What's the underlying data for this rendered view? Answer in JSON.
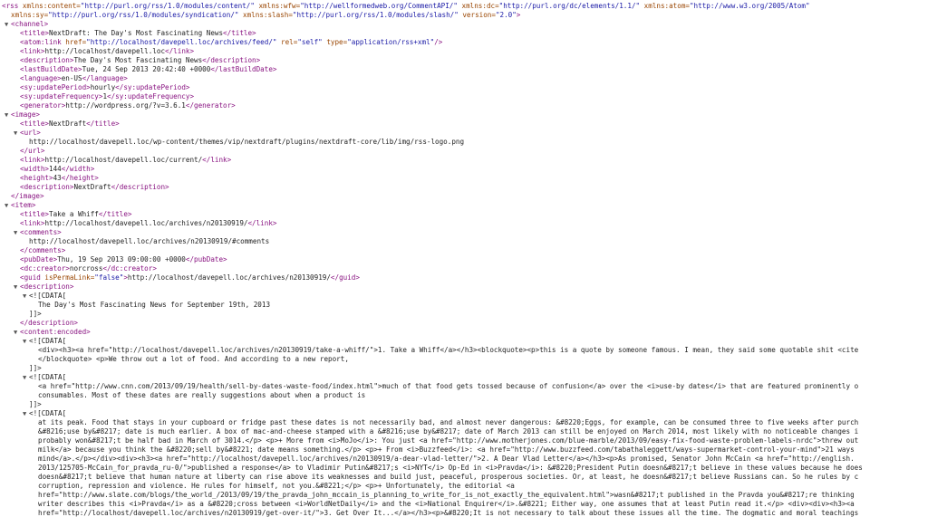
{
  "document": {
    "lines": [
      {
        "level": 0,
        "toggle": "▼",
        "tokens": [
          {
            "t": "tg",
            "v": "<rss"
          },
          {
            "t": "at",
            "v": " xmlns:content="
          },
          {
            "t": "av",
            "v": "\"http://purl.org/rss/1.0/modules/content/\""
          },
          {
            "t": "at",
            "v": " xmlns:wfw="
          },
          {
            "t": "av",
            "v": "\"http://wellformedweb.org/CommentAPI/\""
          },
          {
            "t": "at",
            "v": " xmlns:dc="
          },
          {
            "t": "av",
            "v": "\"http://purl.org/dc/elements/1.1/\""
          },
          {
            "t": "at",
            "v": " xmlns:atom="
          },
          {
            "t": "av",
            "v": "\"http://www.w3.org/2005/Atom\""
          }
        ]
      },
      {
        "level": 1,
        "tokens": [
          {
            "t": "at",
            "v": "xmlns:sy="
          },
          {
            "t": "av",
            "v": "\"http://purl.org/rss/1.0/modules/syndication/\""
          },
          {
            "t": "at",
            "v": " xmlns:slash="
          },
          {
            "t": "av",
            "v": "\"http://purl.org/rss/1.0/modules/slash/\""
          },
          {
            "t": "at",
            "v": " version="
          },
          {
            "t": "av",
            "v": "\"2.0\""
          },
          {
            "t": "tg",
            "v": ">"
          }
        ]
      },
      {
        "level": 1,
        "toggle": "▼",
        "tokens": [
          {
            "t": "tg",
            "v": "<channel>"
          }
        ]
      },
      {
        "level": 2,
        "tokens": [
          {
            "t": "tg",
            "v": "<title>"
          },
          {
            "t": "tx",
            "v": "NextDraft: The Day's Most Fascinating News"
          },
          {
            "t": "tg",
            "v": "</title>"
          }
        ]
      },
      {
        "level": 2,
        "tokens": [
          {
            "t": "tg",
            "v": "<atom:link"
          },
          {
            "t": "at",
            "v": " href="
          },
          {
            "t": "av",
            "v": "\"http://localhost/davepell.loc/archives/feed/\""
          },
          {
            "t": "at",
            "v": " rel="
          },
          {
            "t": "av",
            "v": "\"self\""
          },
          {
            "t": "at",
            "v": " type="
          },
          {
            "t": "av",
            "v": "\"application/rss+xml\""
          },
          {
            "t": "tg",
            "v": "/>"
          }
        ]
      },
      {
        "level": 2,
        "tokens": [
          {
            "t": "tg",
            "v": "<link>"
          },
          {
            "t": "tx",
            "v": "http://localhost/davepell.loc"
          },
          {
            "t": "tg",
            "v": "</link>"
          }
        ]
      },
      {
        "level": 2,
        "tokens": [
          {
            "t": "tg",
            "v": "<description>"
          },
          {
            "t": "tx",
            "v": "The Day's Most Fascinating News"
          },
          {
            "t": "tg",
            "v": "</description>"
          }
        ]
      },
      {
        "level": 2,
        "tokens": [
          {
            "t": "tg",
            "v": "<lastBuildDate>"
          },
          {
            "t": "tx",
            "v": "Tue, 24 Sep 2013 20:42:40 +0000"
          },
          {
            "t": "tg",
            "v": "</lastBuildDate>"
          }
        ]
      },
      {
        "level": 2,
        "tokens": [
          {
            "t": "tg",
            "v": "<language>"
          },
          {
            "t": "tx",
            "v": "en-US"
          },
          {
            "t": "tg",
            "v": "</language>"
          }
        ]
      },
      {
        "level": 2,
        "tokens": [
          {
            "t": "tg",
            "v": "<sy:updatePeriod>"
          },
          {
            "t": "tx",
            "v": "hourly"
          },
          {
            "t": "tg",
            "v": "</sy:updatePeriod>"
          }
        ]
      },
      {
        "level": 2,
        "tokens": [
          {
            "t": "tg",
            "v": "<sy:updateFrequency>"
          },
          {
            "t": "tx",
            "v": "1"
          },
          {
            "t": "tg",
            "v": "</sy:updateFrequency>"
          }
        ]
      },
      {
        "level": 2,
        "tokens": [
          {
            "t": "tg",
            "v": "<generator>"
          },
          {
            "t": "tx",
            "v": "http://wordpress.org/?v=3.6.1"
          },
          {
            "t": "tg",
            "v": "</generator>"
          }
        ]
      },
      {
        "level": 1,
        "toggle": "▼",
        "tokens": [
          {
            "t": "tg",
            "v": "<image>"
          }
        ]
      },
      {
        "level": 2,
        "tokens": [
          {
            "t": "tg",
            "v": "<title>"
          },
          {
            "t": "tx",
            "v": "NextDraft"
          },
          {
            "t": "tg",
            "v": "</title>"
          }
        ]
      },
      {
        "level": 2,
        "toggle": "▼",
        "tokens": [
          {
            "t": "tg",
            "v": "<url>"
          }
        ]
      },
      {
        "level": 3,
        "tokens": [
          {
            "t": "tx",
            "v": "http://localhost/davepell.loc/wp-content/themes/vip/nextdraft/plugins/nextdraft-core/lib/img/rss-logo.png"
          }
        ]
      },
      {
        "level": 2,
        "tokens": [
          {
            "t": "tg",
            "v": "</url>"
          }
        ]
      },
      {
        "level": 2,
        "tokens": [
          {
            "t": "tg",
            "v": "<link>"
          },
          {
            "t": "tx",
            "v": "http://localhost/davepell.loc/current/"
          },
          {
            "t": "tg",
            "v": "</link>"
          }
        ]
      },
      {
        "level": 2,
        "tokens": [
          {
            "t": "tg",
            "v": "<width>"
          },
          {
            "t": "tx",
            "v": "144"
          },
          {
            "t": "tg",
            "v": "</width>"
          }
        ]
      },
      {
        "level": 2,
        "tokens": [
          {
            "t": "tg",
            "v": "<height>"
          },
          {
            "t": "tx",
            "v": "43"
          },
          {
            "t": "tg",
            "v": "</height>"
          }
        ]
      },
      {
        "level": 2,
        "tokens": [
          {
            "t": "tg",
            "v": "<description>"
          },
          {
            "t": "tx",
            "v": "NextDraft"
          },
          {
            "t": "tg",
            "v": "</description>"
          }
        ]
      },
      {
        "level": 1,
        "tokens": [
          {
            "t": "tg",
            "v": "</image>"
          }
        ]
      },
      {
        "level": 1,
        "toggle": "▼",
        "tokens": [
          {
            "t": "tg",
            "v": "<item>"
          }
        ]
      },
      {
        "level": 2,
        "tokens": [
          {
            "t": "tg",
            "v": "<title>"
          },
          {
            "t": "tx",
            "v": "Take a Whiff"
          },
          {
            "t": "tg",
            "v": "</title>"
          }
        ]
      },
      {
        "level": 2,
        "tokens": [
          {
            "t": "tg",
            "v": "<link>"
          },
          {
            "t": "tx",
            "v": "http://localhost/davepell.loc/archives/n20130919/"
          },
          {
            "t": "tg",
            "v": "</link>"
          }
        ]
      },
      {
        "level": 2,
        "toggle": "▼",
        "tokens": [
          {
            "t": "tg",
            "v": "<comments>"
          }
        ]
      },
      {
        "level": 3,
        "tokens": [
          {
            "t": "tx",
            "v": "http://localhost/davepell.loc/archives/n20130919/#comments"
          }
        ]
      },
      {
        "level": 2,
        "tokens": [
          {
            "t": "tg",
            "v": "</comments>"
          }
        ]
      },
      {
        "level": 2,
        "tokens": [
          {
            "t": "tg",
            "v": "<pubDate>"
          },
          {
            "t": "tx",
            "v": "Thu, 19 Sep 2013 09:00:00 +0000"
          },
          {
            "t": "tg",
            "v": "</pubDate>"
          }
        ]
      },
      {
        "level": 2,
        "tokens": [
          {
            "t": "tg",
            "v": "<dc:creator>"
          },
          {
            "t": "tx",
            "v": "norcross"
          },
          {
            "t": "tg",
            "v": "</dc:creator>"
          }
        ]
      },
      {
        "level": 2,
        "tokens": [
          {
            "t": "tg",
            "v": "<guid"
          },
          {
            "t": "at",
            "v": " isPermaLink="
          },
          {
            "t": "av",
            "v": "\"false\""
          },
          {
            "t": "tg",
            "v": ">"
          },
          {
            "t": "tx",
            "v": "http://localhost/davepell.loc/archives/n20130919/"
          },
          {
            "t": "tg",
            "v": "</guid>"
          }
        ]
      },
      {
        "level": 2,
        "toggle": "▼",
        "tokens": [
          {
            "t": "tg",
            "v": "<description>"
          }
        ]
      },
      {
        "level": 3,
        "toggle": "▼",
        "tokens": [
          {
            "t": "tx",
            "v": "<![CDATA["
          }
        ]
      },
      {
        "level": 4,
        "tokens": [
          {
            "t": "tx",
            "v": "The Day's Most Fascinating News for September 19th, 2013"
          }
        ]
      },
      {
        "level": 3,
        "tokens": [
          {
            "t": "tx",
            "v": "]]>"
          }
        ]
      },
      {
        "level": 2,
        "tokens": [
          {
            "t": "tg",
            "v": "</description>"
          }
        ]
      },
      {
        "level": 2,
        "toggle": "▼",
        "tokens": [
          {
            "t": "tg",
            "v": "<content:encoded>"
          }
        ]
      },
      {
        "level": 3,
        "toggle": "▼",
        "tokens": [
          {
            "t": "tx",
            "v": "<![CDATA["
          }
        ]
      },
      {
        "level": 4,
        "tokens": [
          {
            "t": "tx",
            "v": "<div><h3><a href=\"http://localhost/davepell.loc/archives/n20130919/take-a-whiff/\">1. Take a Whiff</a></h3><blockquote><p>this is a quote by someone famous. I mean, they said some quotable shit <cite"
          }
        ]
      },
      {
        "level": 4,
        "tokens": [
          {
            "t": "tx",
            "v": "</blockquote> <p>We throw out a lot of food. And according to a new report,"
          }
        ]
      },
      {
        "level": 3,
        "tokens": [
          {
            "t": "tx",
            "v": "]]>"
          }
        ]
      },
      {
        "level": 3,
        "toggle": "▼",
        "tokens": [
          {
            "t": "tx",
            "v": "<![CDATA["
          }
        ]
      },
      {
        "level": 4,
        "tokens": [
          {
            "t": "tx",
            "v": "<a href=\"http://www.cnn.com/2013/09/19/health/sell-by-dates-waste-food/index.html\">much of that food gets tossed because of confusion</a> over the <i>use-by dates</i> that are featured prominently o"
          }
        ]
      },
      {
        "level": 4,
        "tokens": [
          {
            "t": "tx",
            "v": "consumables. Most of these dates are really suggestions about when a product is"
          }
        ]
      },
      {
        "level": 3,
        "tokens": [
          {
            "t": "tx",
            "v": "]]>"
          }
        ]
      },
      {
        "level": 3,
        "toggle": "▼",
        "tokens": [
          {
            "t": "tx",
            "v": "<![CDATA["
          }
        ]
      },
      {
        "level": 4,
        "tokens": [
          {
            "t": "tx",
            "v": "at its peak. Food that stays in your cupboard or fridge past these dates is not necessarily bad, and almost never dangerous: &#8220;Eggs, for example, can be consumed three to five weeks after purch"
          }
        ]
      },
      {
        "level": 4,
        "tokens": [
          {
            "t": "tx",
            "v": "&#8216;use by&#8217; date is much earlier. A box of mac-and-cheese stamped with a &#8216;use by&#8217; date of March 2013 can still be enjoyed on March 2014, most likely with no noticeable changes i"
          }
        ]
      },
      {
        "level": 4,
        "tokens": [
          {
            "t": "tx",
            "v": "probably won&#8217;t be half bad in March of 3014.</p> <p>+ More from <i>MoJo</i>: You just <a href=\"http://www.motherjones.com/blue-marble/2013/09/easy-fix-food-waste-problem-labels-nrdc\">threw out"
          }
        ]
      },
      {
        "level": 4,
        "tokens": [
          {
            "t": "tx",
            "v": "milk</a> because you think the &#8220;sell by&#8221; date means something.</p> <p>+ From <i>Buzzfeed</i>: <a href=\"http://www.buzzfeed.com/tabathaleggett/ways-supermarket-control-your-mind\">21 ways"
          }
        ]
      },
      {
        "level": 4,
        "tokens": [
          {
            "t": "tx",
            "v": "mind</a>.</p></div><div><h3><a href=\"http://localhost/davepell.loc/archives/n20130919/a-dear-vlad-letter/\">2. A Dear Vlad Letter</a></h3><p>As promised, Senator John McCain <a href=\"http://english."
          }
        ]
      },
      {
        "level": 4,
        "tokens": [
          {
            "t": "tx",
            "v": "2013/125705-McCain_for_pravda_ru-0/\">published a response</a> to Vladimir Putin&#8217;s <i>NYT</i> Op-Ed in <i>Pravda</i>: &#8220;President Putin doesn&#8217;t believe in these values because he does"
          }
        ]
      },
      {
        "level": 4,
        "tokens": [
          {
            "t": "tx",
            "v": "doesn&#8217;t believe that human nature at liberty can rise above its weaknesses and build just, peaceful, prosperous societies. Or, at least, he doesn&#8217;t believe Russians can. So he rules by c"
          }
        ]
      },
      {
        "level": 4,
        "tokens": [
          {
            "t": "tx",
            "v": "corruption, repression and violence. He rules for himself, not you.&#8221;</p> <p>+ Unfortunately, the editorial <a"
          }
        ]
      },
      {
        "level": 4,
        "tokens": [
          {
            "t": "tx",
            "v": "href=\"http://www.slate.com/blogs/the_world_/2013/09/19/the_pravda_john_mccain_is_planning_to_write_for_is_not_exactly_the_equivalent.html\">wasn&#8217;t published in the Pravda you&#8217;re thinking"
          }
        ]
      },
      {
        "level": 4,
        "tokens": [
          {
            "t": "tx",
            "v": "writer describes this <i>Pravda</i> as a &#8220;cross between <i>WorldNetDaily</i> and the <i>National Enquirer</i>.&#8221; Either way, one assumes that at least Putin read it.</p> <div><div><h3><a"
          }
        ]
      },
      {
        "level": 4,
        "tokens": [
          {
            "t": "tx",
            "v": "href=\"http://localhost/davepell.loc/archives/n20130919/get-over-it/\">3. Get Over It...</a></h3><p>&#8220;It is not necessary to talk about these issues all the time. The dogmatic and moral teachings"
          }
        ]
      }
    ]
  }
}
